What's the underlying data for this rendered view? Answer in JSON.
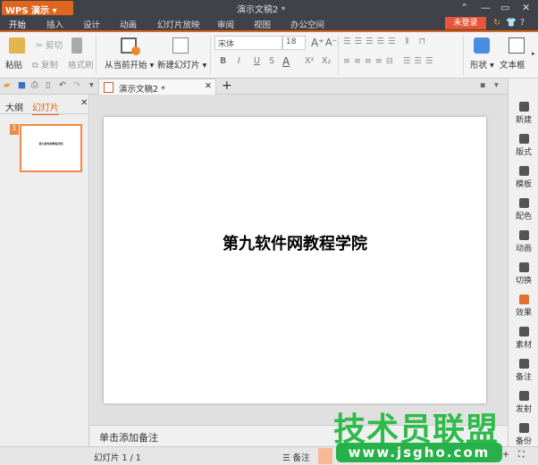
{
  "app": {
    "name": "WPS 演示",
    "doc_title": "演示文稿2 *"
  },
  "menu": {
    "tabs": [
      "开始",
      "插入",
      "设计",
      "动画",
      "幻灯片放映",
      "审阅",
      "视图",
      "办公空间"
    ],
    "login": "未登录",
    "help": "?"
  },
  "ribbon": {
    "paste": "粘贴",
    "cut": "剪切",
    "copy": "复制",
    "format_painter": "格式刷",
    "from_current": "从当前开始",
    "new_slide": "新建幻灯片",
    "font": "宋体",
    "font_size": "18",
    "bold": "B",
    "italic": "I",
    "underline": "U",
    "strike": "S",
    "font_color": "A",
    "superscript": "X²",
    "subscript": "X₂",
    "shape": "形状",
    "textbox": "文本框"
  },
  "doc_tab": {
    "label": "演示文稿2 *"
  },
  "left_panel": {
    "tabs": [
      "大纲",
      "幻灯片"
    ],
    "thumb_number": "1"
  },
  "slide": {
    "text": "第九软件网教程学院"
  },
  "notes": {
    "placeholder": "单击添加备注"
  },
  "right_bar": [
    "新建",
    "版式",
    "模板",
    "配色",
    "动画",
    "切换",
    "效果",
    "素材",
    "备注",
    "发射",
    "备份"
  ],
  "status": {
    "slide_info": "幻灯片 1 / 1",
    "notes_btn": "备注"
  },
  "watermark": {
    "title": "技术员联盟",
    "url": "www.jsgho.com"
  }
}
